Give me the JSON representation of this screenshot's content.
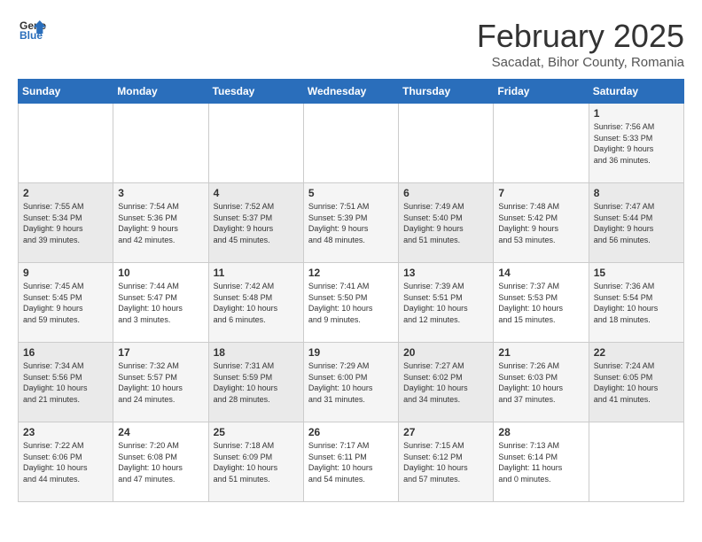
{
  "logo": {
    "line1": "General",
    "line2": "Blue"
  },
  "title": "February 2025",
  "location": "Sacadat, Bihor County, Romania",
  "days_header": [
    "Sunday",
    "Monday",
    "Tuesday",
    "Wednesday",
    "Thursday",
    "Friday",
    "Saturday"
  ],
  "weeks": [
    [
      {
        "day": "",
        "info": ""
      },
      {
        "day": "",
        "info": ""
      },
      {
        "day": "",
        "info": ""
      },
      {
        "day": "",
        "info": ""
      },
      {
        "day": "",
        "info": ""
      },
      {
        "day": "",
        "info": ""
      },
      {
        "day": "1",
        "info": "Sunrise: 7:56 AM\nSunset: 5:33 PM\nDaylight: 9 hours\nand 36 minutes."
      }
    ],
    [
      {
        "day": "2",
        "info": "Sunrise: 7:55 AM\nSunset: 5:34 PM\nDaylight: 9 hours\nand 39 minutes."
      },
      {
        "day": "3",
        "info": "Sunrise: 7:54 AM\nSunset: 5:36 PM\nDaylight: 9 hours\nand 42 minutes."
      },
      {
        "day": "4",
        "info": "Sunrise: 7:52 AM\nSunset: 5:37 PM\nDaylight: 9 hours\nand 45 minutes."
      },
      {
        "day": "5",
        "info": "Sunrise: 7:51 AM\nSunset: 5:39 PM\nDaylight: 9 hours\nand 48 minutes."
      },
      {
        "day": "6",
        "info": "Sunrise: 7:49 AM\nSunset: 5:40 PM\nDaylight: 9 hours\nand 51 minutes."
      },
      {
        "day": "7",
        "info": "Sunrise: 7:48 AM\nSunset: 5:42 PM\nDaylight: 9 hours\nand 53 minutes."
      },
      {
        "day": "8",
        "info": "Sunrise: 7:47 AM\nSunset: 5:44 PM\nDaylight: 9 hours\nand 56 minutes."
      }
    ],
    [
      {
        "day": "9",
        "info": "Sunrise: 7:45 AM\nSunset: 5:45 PM\nDaylight: 9 hours\nand 59 minutes."
      },
      {
        "day": "10",
        "info": "Sunrise: 7:44 AM\nSunset: 5:47 PM\nDaylight: 10 hours\nand 3 minutes."
      },
      {
        "day": "11",
        "info": "Sunrise: 7:42 AM\nSunset: 5:48 PM\nDaylight: 10 hours\nand 6 minutes."
      },
      {
        "day": "12",
        "info": "Sunrise: 7:41 AM\nSunset: 5:50 PM\nDaylight: 10 hours\nand 9 minutes."
      },
      {
        "day": "13",
        "info": "Sunrise: 7:39 AM\nSunset: 5:51 PM\nDaylight: 10 hours\nand 12 minutes."
      },
      {
        "day": "14",
        "info": "Sunrise: 7:37 AM\nSunset: 5:53 PM\nDaylight: 10 hours\nand 15 minutes."
      },
      {
        "day": "15",
        "info": "Sunrise: 7:36 AM\nSunset: 5:54 PM\nDaylight: 10 hours\nand 18 minutes."
      }
    ],
    [
      {
        "day": "16",
        "info": "Sunrise: 7:34 AM\nSunset: 5:56 PM\nDaylight: 10 hours\nand 21 minutes."
      },
      {
        "day": "17",
        "info": "Sunrise: 7:32 AM\nSunset: 5:57 PM\nDaylight: 10 hours\nand 24 minutes."
      },
      {
        "day": "18",
        "info": "Sunrise: 7:31 AM\nSunset: 5:59 PM\nDaylight: 10 hours\nand 28 minutes."
      },
      {
        "day": "19",
        "info": "Sunrise: 7:29 AM\nSunset: 6:00 PM\nDaylight: 10 hours\nand 31 minutes."
      },
      {
        "day": "20",
        "info": "Sunrise: 7:27 AM\nSunset: 6:02 PM\nDaylight: 10 hours\nand 34 minutes."
      },
      {
        "day": "21",
        "info": "Sunrise: 7:26 AM\nSunset: 6:03 PM\nDaylight: 10 hours\nand 37 minutes."
      },
      {
        "day": "22",
        "info": "Sunrise: 7:24 AM\nSunset: 6:05 PM\nDaylight: 10 hours\nand 41 minutes."
      }
    ],
    [
      {
        "day": "23",
        "info": "Sunrise: 7:22 AM\nSunset: 6:06 PM\nDaylight: 10 hours\nand 44 minutes."
      },
      {
        "day": "24",
        "info": "Sunrise: 7:20 AM\nSunset: 6:08 PM\nDaylight: 10 hours\nand 47 minutes."
      },
      {
        "day": "25",
        "info": "Sunrise: 7:18 AM\nSunset: 6:09 PM\nDaylight: 10 hours\nand 51 minutes."
      },
      {
        "day": "26",
        "info": "Sunrise: 7:17 AM\nSunset: 6:11 PM\nDaylight: 10 hours\nand 54 minutes."
      },
      {
        "day": "27",
        "info": "Sunrise: 7:15 AM\nSunset: 6:12 PM\nDaylight: 10 hours\nand 57 minutes."
      },
      {
        "day": "28",
        "info": "Sunrise: 7:13 AM\nSunset: 6:14 PM\nDaylight: 11 hours\nand 0 minutes."
      },
      {
        "day": "",
        "info": ""
      }
    ]
  ]
}
